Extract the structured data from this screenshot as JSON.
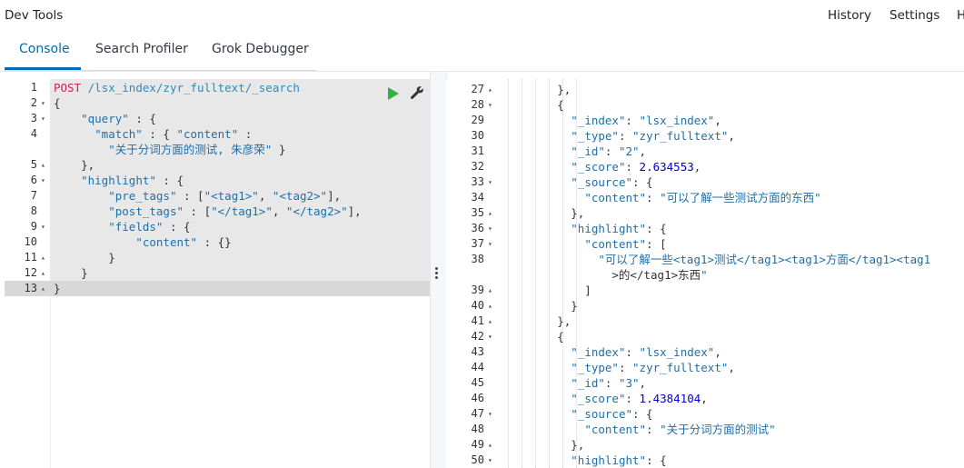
{
  "app": {
    "title": "Dev Tools",
    "nav": [
      "History",
      "Settings",
      "H"
    ]
  },
  "tabs": [
    {
      "label": "Console",
      "active": true
    },
    {
      "label": "Search Profiler",
      "active": false
    },
    {
      "label": "Grok Debugger",
      "active": false
    }
  ],
  "editor": {
    "method": "POST",
    "path": "/lsx_index/zyr_fulltext/_search",
    "lines": [
      {
        "n": "1",
        "fold": ""
      },
      {
        "n": "2",
        "fold": "▾",
        "text": "{"
      },
      {
        "n": "3",
        "fold": "▾",
        "text": "    \"query\" : {"
      },
      {
        "n": "4",
        "fold": "",
        "text": "      \"match\" : { \"content\" :"
      },
      {
        "n": "",
        "fold": "",
        "text": "        \"关于分词方面的测试, 朱彦荣\" }"
      },
      {
        "n": "5",
        "fold": "▴",
        "text": "    },"
      },
      {
        "n": "6",
        "fold": "▾",
        "text": "    \"highlight\" : {"
      },
      {
        "n": "7",
        "fold": "",
        "text": "        \"pre_tags\" : [\"<tag1>\", \"<tag2>\"],"
      },
      {
        "n": "8",
        "fold": "",
        "text": "        \"post_tags\" : [\"</tag1>\", \"</tag2>\"],"
      },
      {
        "n": "9",
        "fold": "▾",
        "text": "        \"fields\" : {"
      },
      {
        "n": "10",
        "fold": "",
        "text": "            \"content\" : {}"
      },
      {
        "n": "11",
        "fold": "▴",
        "text": "        }"
      },
      {
        "n": "12",
        "fold": "▴",
        "text": "    }"
      },
      {
        "n": "13",
        "fold": "▴",
        "text": "}"
      }
    ]
  },
  "output": {
    "lines": [
      {
        "n": "27",
        "fold": "▴",
        "text": "        },"
      },
      {
        "n": "28",
        "fold": "▾",
        "text": "        {"
      },
      {
        "n": "29",
        "fold": "",
        "text": "          \"_index\": \"lsx_index\","
      },
      {
        "n": "30",
        "fold": "",
        "text": "          \"_type\": \"zyr_fulltext\","
      },
      {
        "n": "31",
        "fold": "",
        "text": "          \"_id\": \"2\","
      },
      {
        "n": "32",
        "fold": "",
        "text": "          \"_score\": 2.634553,"
      },
      {
        "n": "33",
        "fold": "▾",
        "text": "          \"_source\": {"
      },
      {
        "n": "34",
        "fold": "",
        "text": "            \"content\": \"可以了解一些测试方面的东西\""
      },
      {
        "n": "35",
        "fold": "▴",
        "text": "          },"
      },
      {
        "n": "36",
        "fold": "▾",
        "text": "          \"highlight\": {"
      },
      {
        "n": "37",
        "fold": "▾",
        "text": "            \"content\": ["
      },
      {
        "n": "38",
        "fold": "",
        "text": "              \"可以了解一些<tag1>测试</tag1><tag1>方面</tag1><tag1"
      },
      {
        "n": "",
        "fold": "",
        "text": "                >的</tag1>东西\""
      },
      {
        "n": "39",
        "fold": "▴",
        "text": "            ]"
      },
      {
        "n": "40",
        "fold": "▴",
        "text": "          }"
      },
      {
        "n": "41",
        "fold": "▴",
        "text": "        },"
      },
      {
        "n": "42",
        "fold": "▾",
        "text": "        {"
      },
      {
        "n": "43",
        "fold": "",
        "text": "          \"_index\": \"lsx_index\","
      },
      {
        "n": "44",
        "fold": "",
        "text": "          \"_type\": \"zyr_fulltext\","
      },
      {
        "n": "45",
        "fold": "",
        "text": "          \"_id\": \"3\","
      },
      {
        "n": "46",
        "fold": "",
        "text": "          \"_score\": 1.4384104,"
      },
      {
        "n": "47",
        "fold": "▾",
        "text": "          \"_source\": {"
      },
      {
        "n": "48",
        "fold": "",
        "text": "            \"content\": \"关于分词方面的测试\""
      },
      {
        "n": "49",
        "fold": "▴",
        "text": "          },"
      },
      {
        "n": "50",
        "fold": "▾",
        "text": "          \"highlight\": {"
      }
    ]
  },
  "icons": {
    "run": "play-icon",
    "settings": "wrench-icon"
  },
  "colors": {
    "accent": "#006bb4",
    "run_green": "#2fb344",
    "method_red": "#c7254e"
  }
}
